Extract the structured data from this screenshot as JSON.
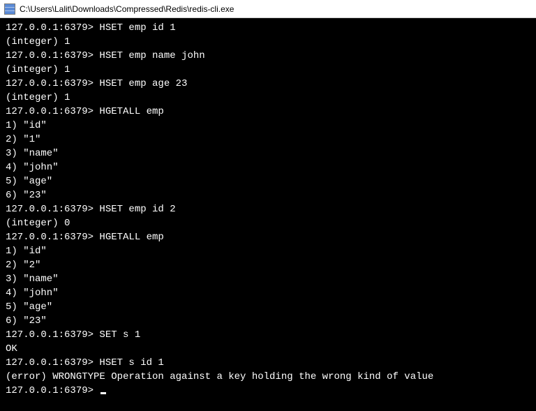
{
  "window": {
    "title": "C:\\Users\\Lalit\\Downloads\\Compressed\\Redis\\redis-cli.exe"
  },
  "prompt": "127.0.0.1:6379> ",
  "lines": [
    {
      "type": "cmd",
      "text": "HSET emp id 1"
    },
    {
      "type": "out",
      "text": "(integer) 1"
    },
    {
      "type": "cmd",
      "text": "HSET emp name john"
    },
    {
      "type": "out",
      "text": "(integer) 1"
    },
    {
      "type": "cmd",
      "text": "HSET emp age 23"
    },
    {
      "type": "out",
      "text": "(integer) 1"
    },
    {
      "type": "cmd",
      "text": "HGETALL emp"
    },
    {
      "type": "out",
      "text": "1) \"id\""
    },
    {
      "type": "out",
      "text": "2) \"1\""
    },
    {
      "type": "out",
      "text": "3) \"name\""
    },
    {
      "type": "out",
      "text": "4) \"john\""
    },
    {
      "type": "out",
      "text": "5) \"age\""
    },
    {
      "type": "out",
      "text": "6) \"23\""
    },
    {
      "type": "cmd",
      "text": "HSET emp id 2"
    },
    {
      "type": "out",
      "text": "(integer) 0"
    },
    {
      "type": "cmd",
      "text": "HGETALL emp"
    },
    {
      "type": "out",
      "text": "1) \"id\""
    },
    {
      "type": "out",
      "text": "2) \"2\""
    },
    {
      "type": "out",
      "text": "3) \"name\""
    },
    {
      "type": "out",
      "text": "4) \"john\""
    },
    {
      "type": "out",
      "text": "5) \"age\""
    },
    {
      "type": "out",
      "text": "6) \"23\""
    },
    {
      "type": "cmd",
      "text": "SET s 1"
    },
    {
      "type": "out",
      "text": "OK"
    },
    {
      "type": "cmd",
      "text": "HSET s id 1"
    },
    {
      "type": "out",
      "text": "(error) WRONGTYPE Operation against a key holding the wrong kind of value"
    },
    {
      "type": "cmd",
      "text": "",
      "cursor": true
    }
  ]
}
